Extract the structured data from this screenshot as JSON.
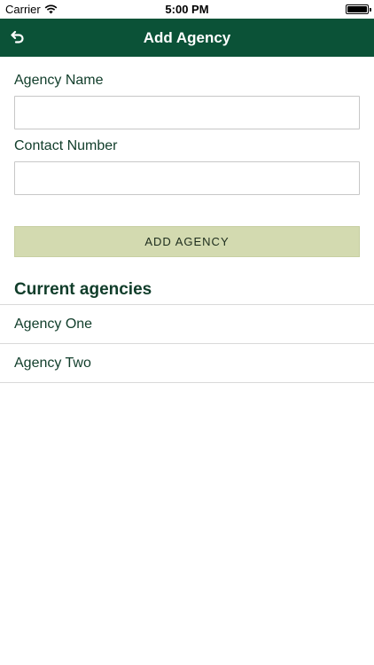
{
  "status_bar": {
    "carrier": "Carrier",
    "time": "5:00 PM"
  },
  "nav_bar": {
    "title": "Add Agency",
    "back_icon": "undo-arrow-icon",
    "color": "#0b5237"
  },
  "form": {
    "agency_name_label": "Agency Name",
    "agency_name_value": "",
    "contact_number_label": "Contact Number",
    "contact_number_value": "",
    "submit_label": "ADD AGENCY",
    "submit_color": "#d3dab0"
  },
  "current_agencies": {
    "title": "Current agencies",
    "items": [
      {
        "label": "Agency One"
      },
      {
        "label": "Agency Two"
      }
    ]
  }
}
